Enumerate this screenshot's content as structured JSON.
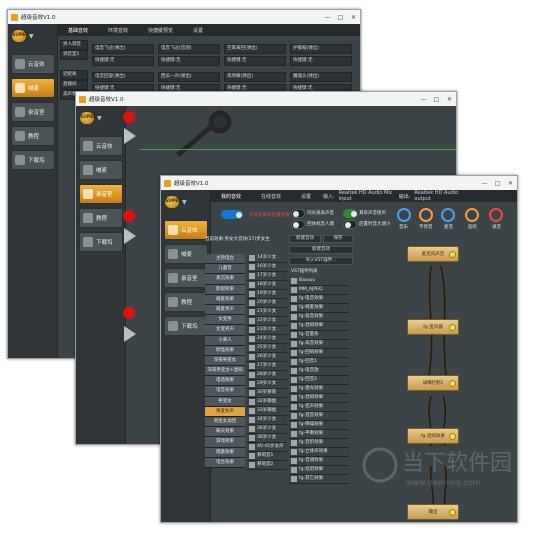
{
  "app_title": "超级音效V1.0",
  "logo_text": "SUPER",
  "window_controls": {
    "minimize": "—",
    "maximize": "□",
    "close": "✕"
  },
  "nav": [
    "云音效",
    "喊麦",
    "录音室",
    "教程",
    "下载坞"
  ],
  "win1": {
    "tabs": [
      "基础音效",
      "环境音效",
      "快捷键预览",
      "设置"
    ],
    "row_labels": [
      "电音飞过(弹出)",
      "电音飞过(首测)",
      "空耳来回(弹出)",
      "护舰喊(弹出)"
    ],
    "row_values": [
      "快捷键:无",
      "快捷键:无",
      "快捷键:无",
      "快捷键:无"
    ],
    "row2_labels": [
      "电音回旋(弹出)",
      "西瓜一声(弹出)",
      "现场嘛(弹出)",
      "魔魂头(弹出)"
    ],
    "left_labels": [
      "男人调音",
      "调音室1",
      "音效1",
      "近距离",
      "直播间",
      "美声要声"
    ]
  },
  "win3": {
    "tabs": [
      "我的音效",
      "在线音效",
      "设置"
    ],
    "input_label": "输入:",
    "input_device": "Realtek HD Audio Mic input",
    "output_label": "输出:",
    "output_device": "Realtek HD Audio output",
    "toggle_labels": [
      "闪光发表声音",
      "回体机音人情",
      "耳朵声音接声",
      "后置时音大调小"
    ],
    "mic_hint": "允许在录屏位置音效",
    "knob_labels": [
      "音乐",
      "不停音",
      "麦克",
      "监听",
      "录音"
    ],
    "current_effect": "当前效果:男女大音效(27)步女生",
    "btn_row": [
      "新建音效",
      "保存"
    ],
    "btn_import": "新建音效",
    "btn_export": "导入VST插件...",
    "vst_header": "VST插件列表",
    "categories": [
      "主持电台",
      "儿童音",
      "真沉效果",
      "影视效果",
      "喊麦效果",
      "喊麦男声",
      "女变男",
      "女变男声",
      "小黄人",
      "搞怪效果",
      "深夜男变女",
      "深夜男变女+混响",
      "电话效果",
      "电音效果",
      "男变女",
      "男变女声",
      "男变女加回",
      "聊天效果",
      "游戏效果",
      "唱歌效果",
      "电台效果"
    ],
    "presets": [
      "14岁少女",
      "16岁少女",
      "17岁少女",
      "18岁少女",
      "19岁少女",
      "20岁少女",
      "21岁少女",
      "22岁少女",
      "23岁少女",
      "24岁少女",
      "25岁少女",
      "26岁少女",
      "27岁少女",
      "28岁少女",
      "29岁少女",
      "30岁萝莉",
      "32岁御姐",
      "33岁御姐",
      "34岁少女",
      "36岁少女",
      "38岁少女",
      "40-45岁女声",
      "萝莉音1",
      "萝莉音2"
    ],
    "plugins": [
      "Bassoo",
      "MM_AJPEQ",
      "fg-电音效果",
      "fg-喊麦效果",
      "fg-低音效果",
      "fg-混响效果",
      "fg-音量条",
      "fg-高音效果",
      "fg-回响效果",
      "fg-回音1",
      "fg-电音放",
      "fg-回音2",
      "fg-激光效果",
      "fg-混响效果",
      "fg-变声效果",
      "fg-混音效果",
      "fg-降噪效果",
      "fg-平衡效果",
      "fg-音阶效果",
      "fg-立体声效果",
      "fg-音调效果",
      "fg-延迟效果",
      "fg-其它效果"
    ],
    "nodes": [
      "麦克风声音",
      "fg-变声器",
      "详细控制1",
      "fg-混响效果",
      "输出"
    ]
  },
  "watermark": {
    "brand": "当下软件园",
    "url": "www.downxia.com"
  },
  "colors": {
    "accent": "#e3a23a",
    "record": "#e01010",
    "panel": "#3d4448",
    "link": "#3ea63e"
  }
}
